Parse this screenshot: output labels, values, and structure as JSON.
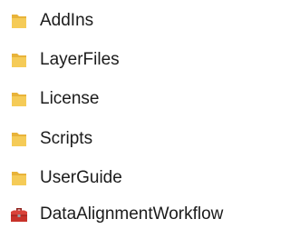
{
  "items": [
    {
      "label": "AddIns",
      "icon": "folder-icon"
    },
    {
      "label": "LayerFiles",
      "icon": "folder-icon"
    },
    {
      "label": "License",
      "icon": "folder-icon"
    },
    {
      "label": "Scripts",
      "icon": "folder-icon"
    },
    {
      "label": "UserGuide",
      "icon": "folder-icon"
    },
    {
      "label": "DataAlignmentWorkflow",
      "icon": "toolbox-icon"
    }
  ],
  "colors": {
    "folder_back": "#e8b33a",
    "folder_front": "#f5cb57",
    "toolbox_red": "#c8322a",
    "toolbox_dark": "#8e1f1a",
    "text": "#1b1b1b"
  }
}
